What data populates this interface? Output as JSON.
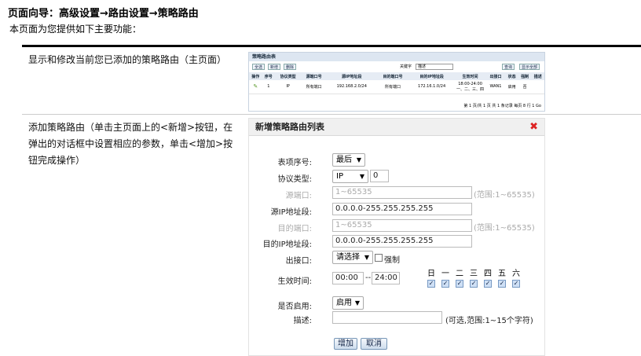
{
  "header": {
    "title": "页面向导：高级设置→路由设置→策略路由",
    "subtitle": "本页面为您提供如下主要功能："
  },
  "rows": [
    {
      "desc": "显示和修改当前您已添加的策略路由（主页面）"
    },
    {
      "desc_lines": [
        "添加策略路由（单击主页面上的<新增>按钮，在",
        "弹出的对话框中设置相应的参数，单击<增加>按",
        "钮完成操作）"
      ]
    }
  ],
  "mini": {
    "title": "策略路由表",
    "buttons": [
      "全选",
      "新增",
      "删除"
    ],
    "keyword_label": "关键字",
    "keyword_value": "描述",
    "search": "查询",
    "show_all": "显示全部",
    "columns": [
      "操作",
      "序号",
      "协议类型",
      "源端口号",
      "源IP地址段",
      "目的端口号",
      "目的IP地址段",
      "生效时间",
      "出接口",
      "状态",
      "强制",
      "描述"
    ],
    "row": {
      "index": "1",
      "proto": "IP",
      "src_port": "所有端口",
      "src_ip": "192.168.2.0/24",
      "dst_port": "所有端口",
      "dst_ip": "172.16.1.0/24",
      "time": "18:00-24:00一、二、三、四",
      "iface": "WAN1",
      "status": "启用",
      "force": "否",
      "desc": ""
    },
    "pager": "第 1 页/共 1 页 共 1 条记录 每页 8 行 1 Go"
  },
  "dialog": {
    "title": "新增策略路由列表",
    "fields": {
      "index": {
        "label": "表项序号:",
        "value": "最后"
      },
      "proto": {
        "label": "协议类型:",
        "value": "IP",
        "num": "0"
      },
      "src_port": {
        "label": "源端口:",
        "placeholder": "1~65535",
        "hint": "(范围:1~65535)"
      },
      "src_ip": {
        "label": "源IP地址段:",
        "value": "0.0.0.0-255.255.255.255"
      },
      "dst_port": {
        "label": "目的端口:",
        "placeholder": "1~65535",
        "hint": "(范围:1~65535)"
      },
      "dst_ip": {
        "label": "目的IP地址段:",
        "value": "0.0.0.0-255.255.255.255"
      },
      "iface": {
        "label": "出接口:",
        "value": "请选择",
        "force": "强制"
      },
      "time": {
        "label": "生效时间:",
        "start": "00:00",
        "sep": "--",
        "end": "24:00",
        "days": [
          "日",
          "一",
          "二",
          "三",
          "四",
          "五",
          "六"
        ]
      },
      "enable": {
        "label": "是否启用:",
        "value": "启用"
      },
      "desc": {
        "label": "描述:",
        "hint": "(可选,范围:1~15个字符)"
      }
    },
    "add": "增加",
    "cancel": "取消"
  }
}
